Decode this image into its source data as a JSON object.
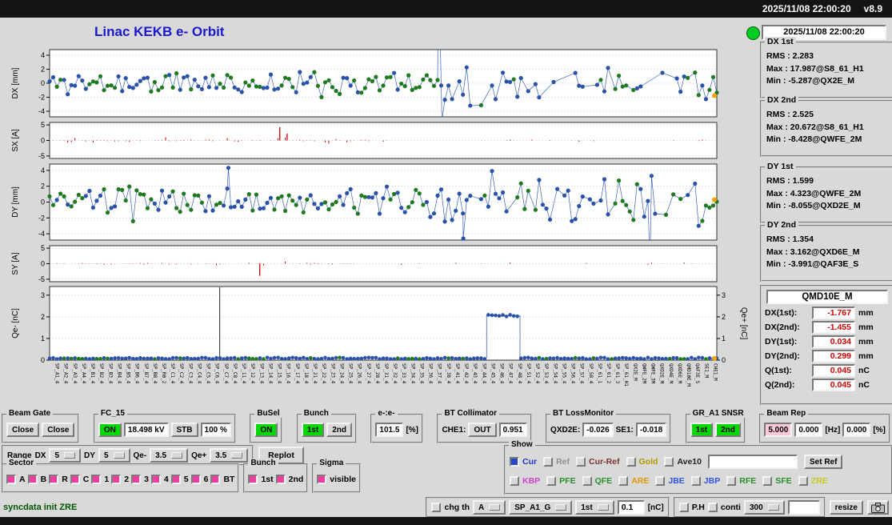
{
  "topbar": {
    "datetime": "2025/11/08 22:00:20",
    "version": "v8.9"
  },
  "header": {
    "title": "Linac KEKB e- Orbit",
    "clock": "2025/11/08 22:00:20"
  },
  "colors": {
    "title_blue": "#1a1acc",
    "indicator_green": "#00cc22",
    "on_green": "#00d900",
    "set_pink": "#ffc9d9",
    "check_pink": "#ee3fa0",
    "value_red": "#cc0000"
  },
  "stats": [
    {
      "title": "DX 1st",
      "lines": [
        "RMS : 2.283",
        "Max : 17.987@S8_61_H1",
        "Min : -5.287@QX2E_M"
      ]
    },
    {
      "title": "DX 2nd",
      "lines": [
        "RMS : 2.525",
        "Max : 20.672@S8_61_H1",
        "Min : -8.428@QWFE_2M"
      ]
    },
    {
      "title": "DY 1st",
      "lines": [
        "RMS : 1.599",
        "Max : 4.323@QWFE_2M",
        "Min : -8.055@QXD2E_M"
      ]
    },
    {
      "title": "DY 2nd",
      "lines": [
        "RMS : 1.354",
        "Max : 3.162@QXD6E_M",
        "Min : -3.991@QAF3E_S"
      ]
    }
  ],
  "qmd": {
    "title": "QMD10E_M",
    "rows": [
      {
        "label": "DX(1st):",
        "value": "-1.767",
        "unit": "mm"
      },
      {
        "label": "DX(2nd):",
        "value": "-1.455",
        "unit": "mm"
      },
      {
        "label": "DY(1st):",
        "value": "0.034",
        "unit": "mm"
      },
      {
        "label": "DY(2nd):",
        "value": "0.299",
        "unit": "mm"
      },
      {
        "label": "Q(1st):",
        "value": "0.045",
        "unit": "nC"
      },
      {
        "label": "Q(2nd):",
        "value": "0.045",
        "unit": "nC"
      }
    ]
  },
  "plots": {
    "n_points": 185,
    "seeds": {
      "dx": 11,
      "sx": 22,
      "dy": 33,
      "sy": 44,
      "qe": 55
    },
    "colors": {
      "blue": "#2a52a8",
      "green": "#1f7a1f",
      "red": "#cc0000",
      "orange": "#f5a300",
      "line": "#3a62b8"
    },
    "panels": [
      {
        "id": "dx",
        "ylabel": "DX [mm]",
        "yticks": [
          4,
          2,
          0,
          -2,
          -4
        ],
        "yrange": [
          -4.8,
          4.8
        ],
        "series": "orbit",
        "spikes": [
          {
            "f": 0.583,
            "v": 17.9
          },
          {
            "f": 0.588,
            "v": -5.3
          }
        ],
        "marker_value": -1.77
      },
      {
        "id": "sx",
        "ylabel": "SX [A]",
        "yticks": [
          5,
          0,
          -5
        ],
        "yrange": [
          -5.8,
          5.8
        ],
        "series": "bars",
        "tall": [
          {
            "f": 0.345,
            "v": 4.3
          },
          {
            "f": 0.356,
            "v": 2.2
          }
        ]
      },
      {
        "id": "dy",
        "ylabel": "DY [mm]",
        "yticks": [
          4,
          2,
          0,
          -2,
          -4
        ],
        "yrange": [
          -4.8,
          4.8
        ],
        "series": "orbit",
        "spikes": [
          {
            "f": 0.268,
            "v": 4.33
          },
          {
            "f": 0.62,
            "v": -4.6
          },
          {
            "f": 0.9,
            "v": -7.9
          }
        ],
        "marker_value": 0.3
      },
      {
        "id": "sy",
        "ylabel": "SY [A]",
        "yticks": [
          5,
          0,
          -5
        ],
        "yrange": [
          -5.8,
          5.8
        ],
        "series": "bars",
        "tall": [
          {
            "f": 0.315,
            "v": -3.9
          }
        ]
      },
      {
        "id": "qe",
        "ylabel": "Qe- [nC]",
        "ylabel_right": "Qe+ [nC]",
        "yticks": [
          3,
          2,
          1,
          0
        ],
        "yrange": [
          0,
          3.4
        ],
        "series": "charge",
        "divider_frac": 0.255,
        "cluster": {
          "from": 0.655,
          "to": 0.705,
          "value": 2.05
        },
        "marker_value": 0.08
      }
    ],
    "x_axis_labels": [
      "SP_A1_4",
      "SP_A2_4",
      "SP_A3_4",
      "SP_A4_4",
      "SP_B1_4",
      "SP_B2_4",
      "SP_B3_4",
      "SP_B4_4",
      "SP_B5_4",
      "SP_B6_4",
      "SP_B7_4",
      "SP_B8_4",
      "SP_R0_2",
      "SP_C1_4",
      "SP_C2_4",
      "SP_C3_4",
      "SP_C4_4",
      "SP_C5_4",
      "SP_C6_4",
      "SP_C7_4",
      "SP_C8_4",
      "SP_11_4",
      "SP_12_4",
      "SP_13_4",
      "SP_14_4",
      "SP_15_4",
      "SP_16_4",
      "SP_17_4",
      "SP_18_4",
      "SP_21_4",
      "SP_22_4",
      "SP_23_4",
      "SP_24_4",
      "SP_25_4",
      "SP_26_4",
      "SP_27_4",
      "SP_28_4",
      "SP_31_4",
      "SP_32_4",
      "SP_33_4",
      "SP_34_4",
      "SP_35_4",
      "SP_36_4",
      "SP_37_4",
      "SP_38_4",
      "SP_41_4",
      "SP_42_4",
      "SP_43_4",
      "SP_44_4",
      "SP_45_4",
      "SP_46_4",
      "SP_47_4",
      "SP_48_4",
      "SP_51_4",
      "SP_52_4",
      "SP_53_4",
      "SP_54_4",
      "SP_55_4",
      "SP_56_4",
      "SP_57_4",
      "SP_58_4",
      "SP_61_1",
      "SP_61_2",
      "SP_61_3",
      "SP_61_H1",
      "QX2E_M",
      "QWFE_2M",
      "QWFE_3M",
      "QXD2E_M",
      "QXD4E_M",
      "QXD6E_M",
      "QMD10E_M",
      "QAF3E_S",
      "SE1_M",
      "CHE1_M"
    ]
  },
  "controls": {
    "beam_gate": {
      "title": "Beam Gate",
      "close1": "Close",
      "close2": "Close"
    },
    "fc15": {
      "title": "FC_15",
      "on": "ON",
      "kv": "18.498 kV",
      "stb": "STB",
      "pct": "100 %"
    },
    "busel": {
      "title": "BuSel",
      "on": "ON"
    },
    "bunch": {
      "title": "Bunch",
      "first": "1st",
      "second": "2nd"
    },
    "ee": {
      "title": "e-:e-",
      "value": "101.5",
      "unit": "[%]"
    },
    "bt_col": {
      "title": "BT Collimator",
      "che1": "CHE1:",
      "out": "OUT",
      "value": "0.951"
    },
    "bt_loss": {
      "title": "BT LossMonitor",
      "l1": "QXD2E:",
      "v1": "-0.026",
      "l2": "SE1:",
      "v2": "-0.018"
    },
    "gr": {
      "title": "GR_A1 SNSR",
      "first": "1st",
      "second": "2nd"
    },
    "beam_rep": {
      "title": "Beam Rep",
      "v1": "5.000",
      "v2": "0.000",
      "u1": "[Hz]",
      "v3": "0.000",
      "u2": "[%]"
    }
  },
  "range": {
    "label": "Range",
    "dx_label": "DX",
    "dx": "5",
    "dy_label": "DY",
    "dy": "5",
    "qem_label": "Qe-",
    "qem": "3.5",
    "qep_label": "Qe+",
    "qep": "3.5",
    "replot": "Replot"
  },
  "sector": {
    "title": "Sector",
    "items": [
      "A",
      "B",
      "R",
      "C",
      "1",
      "2",
      "3",
      "4",
      "5",
      "6",
      "BT"
    ]
  },
  "bunch_select": {
    "title": "Bunch",
    "items": [
      "1st",
      "2nd"
    ]
  },
  "sigma": {
    "title": "Sigma",
    "items": [
      "visible"
    ]
  },
  "show": {
    "title": "Show",
    "row1": [
      {
        "label": "Cur",
        "color": "#2233cc",
        "box": "#2848c8"
      },
      {
        "label": "Ref",
        "color": "#909090"
      },
      {
        "label": "Cur-Ref",
        "color": "#7a3434"
      },
      {
        "label": "Gold",
        "color": "#b39a00"
      },
      {
        "label": "Ave10",
        "color": "#222222"
      }
    ],
    "ref_input": "",
    "set_ref": "Set Ref",
    "row2": [
      {
        "label": "KBP",
        "color": "#cc44cc"
      },
      {
        "label": "PFE",
        "color": "#2a8f2a"
      },
      {
        "label": "QFE",
        "color": "#2a8f2a"
      },
      {
        "label": "ARE",
        "color": "#dd9900"
      },
      {
        "label": "JBE",
        "color": "#3355dd"
      },
      {
        "label": "JBP",
        "color": "#3355dd"
      },
      {
        "label": "RFE",
        "color": "#2a8f2a"
      },
      {
        "label": "SFE",
        "color": "#2a8f2a"
      },
      {
        "label": "ZRE",
        "color": "#c9c920"
      }
    ]
  },
  "status": {
    "message": "syncdata init ZRE",
    "chg_th": "chg th",
    "level": "A",
    "monitor": "SP_A1_G",
    "bunch": "1st",
    "threshold": "0.1",
    "threshold_unit": "[nC]",
    "ph": "P.H",
    "conti": "conti",
    "points": "300",
    "entry": "",
    "resize": "resize"
  }
}
